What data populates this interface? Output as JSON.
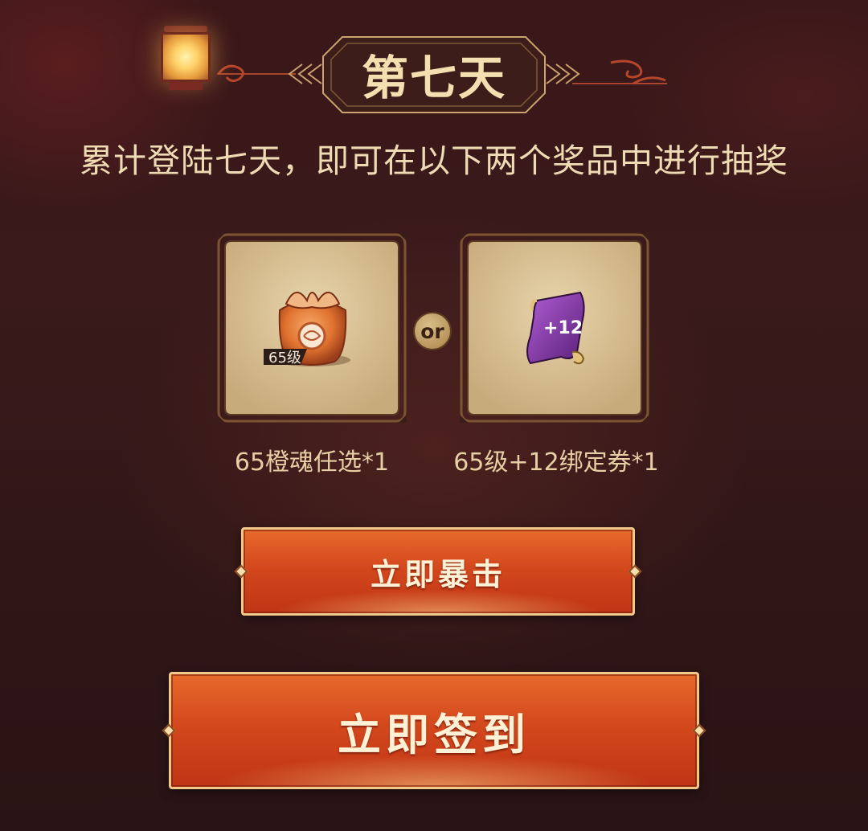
{
  "header": {
    "day_title": "第七天",
    "subtitle": "累计登陆七天，即可在以下两个奖品中进行抽奖"
  },
  "prizes": [
    {
      "icon": "orange-gift-bag-icon",
      "badge": "65级",
      "label": "65橙魂任选*1"
    },
    {
      "icon": "purple-scroll-icon",
      "badge": "+12",
      "label": "65级+12绑定券*1"
    }
  ],
  "or_label": "or",
  "buttons": {
    "strike": "立即暴击",
    "signin": "立即签到"
  },
  "colors": {
    "background": "#361819",
    "gold_text": "#eedbb3",
    "button_orange": "#d4481d",
    "button_border": "#f0c98b",
    "card_fill": "#d9c39a"
  }
}
